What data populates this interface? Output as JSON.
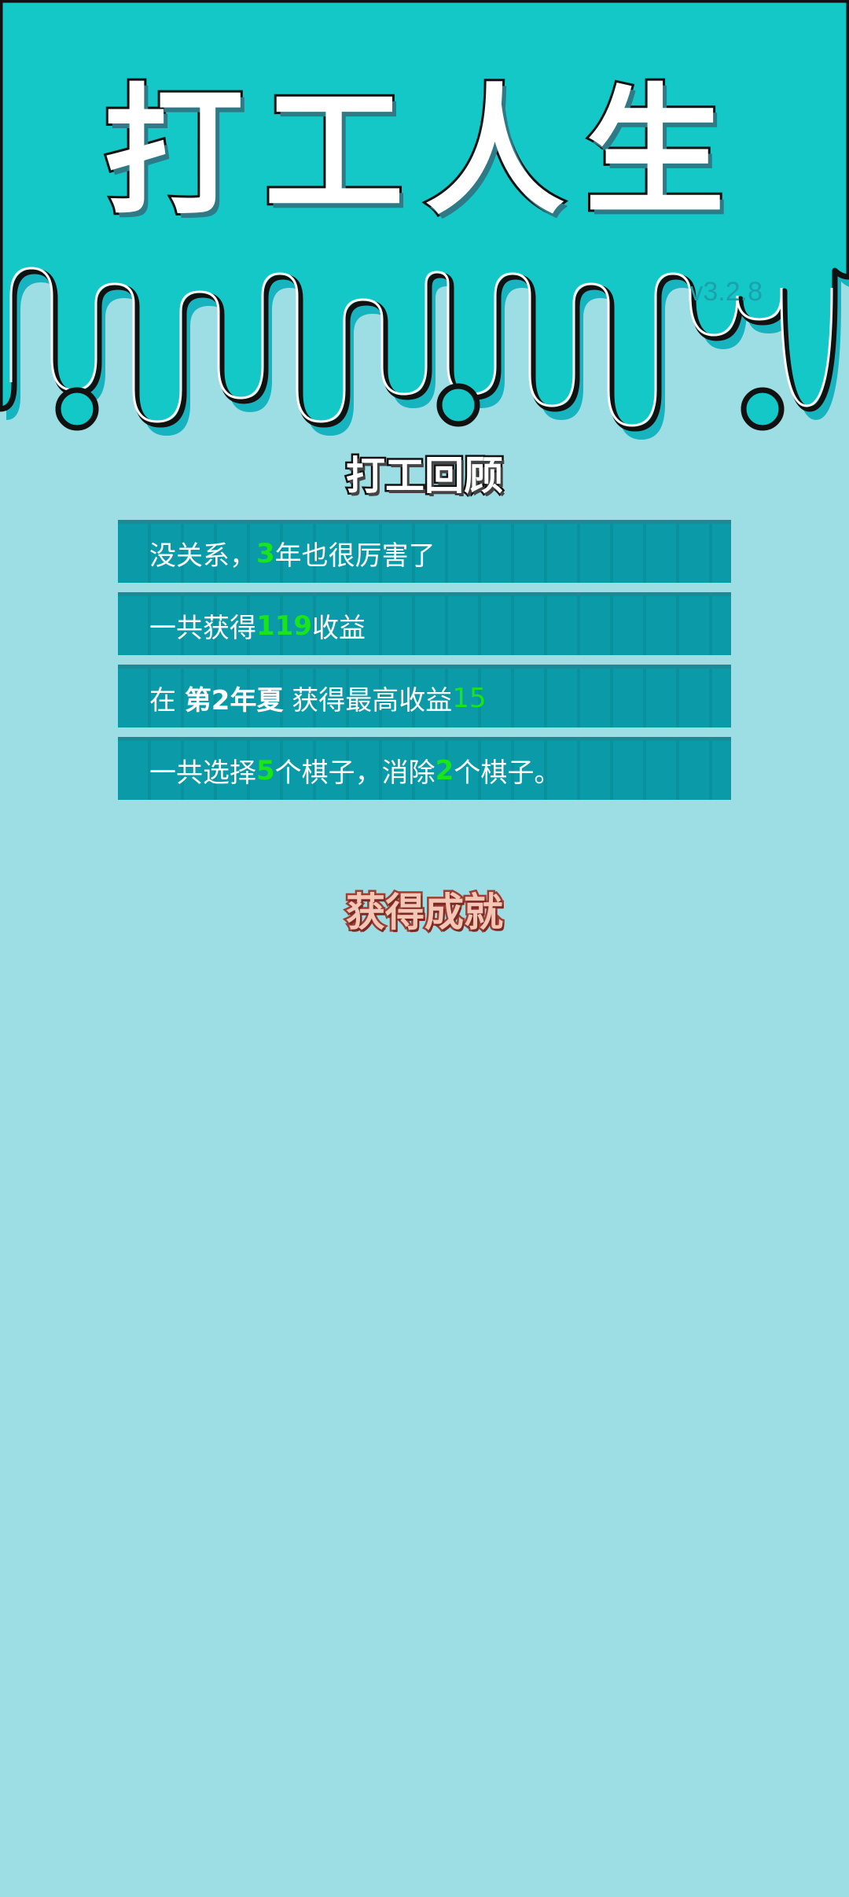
{
  "app": {
    "title": "打工人生",
    "version": "v3.2.8"
  },
  "review": {
    "heading": "打工回顾",
    "rows": [
      {
        "prefix": "没关系，",
        "num": "3",
        "suffix": "年也很厉害了"
      },
      {
        "prefix": "一共获得",
        "num": "119",
        "suffix": "收益"
      },
      {
        "prefix": "在 ",
        "strong": "第2年夏",
        "mid": " 获得最高收益",
        "num": "15"
      },
      {
        "prefix": "一共选择",
        "num": "5",
        "mid": "个棋子，消除",
        "num2": "2",
        "suffix": "个棋子。"
      }
    ]
  },
  "achievements": {
    "heading": "获得成就"
  },
  "colors": {
    "background": "#9ddee5",
    "header": "#14c8c8",
    "row": "#0a9aa8",
    "highlight": "#19e619"
  }
}
